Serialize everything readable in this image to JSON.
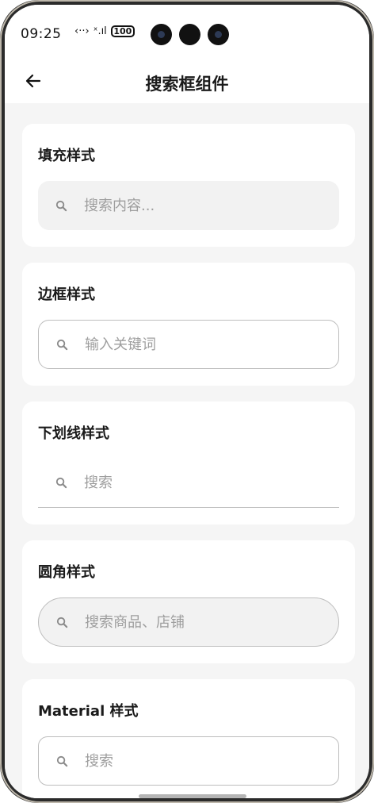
{
  "status_bar": {
    "time": "09:25",
    "signal_glyph": "‹··›",
    "network_glyph": "ˣ.ıl",
    "battery": "100"
  },
  "nav": {
    "title": "搜索框组件"
  },
  "cards": [
    {
      "title": "填充样式",
      "placeholder": "搜索内容..."
    },
    {
      "title": "边框样式",
      "placeholder": "输入关键词"
    },
    {
      "title": "下划线样式",
      "placeholder": "搜索"
    },
    {
      "title": "圆角样式",
      "placeholder": "搜索商品、店铺"
    },
    {
      "title": "Material 样式",
      "placeholder": "搜索"
    }
  ],
  "colors": {
    "background": "#f5f5f5",
    "card": "#ffffff",
    "fill": "#f2f2f2",
    "border": "#bdbdbd",
    "placeholder": "#9e9e9e"
  }
}
